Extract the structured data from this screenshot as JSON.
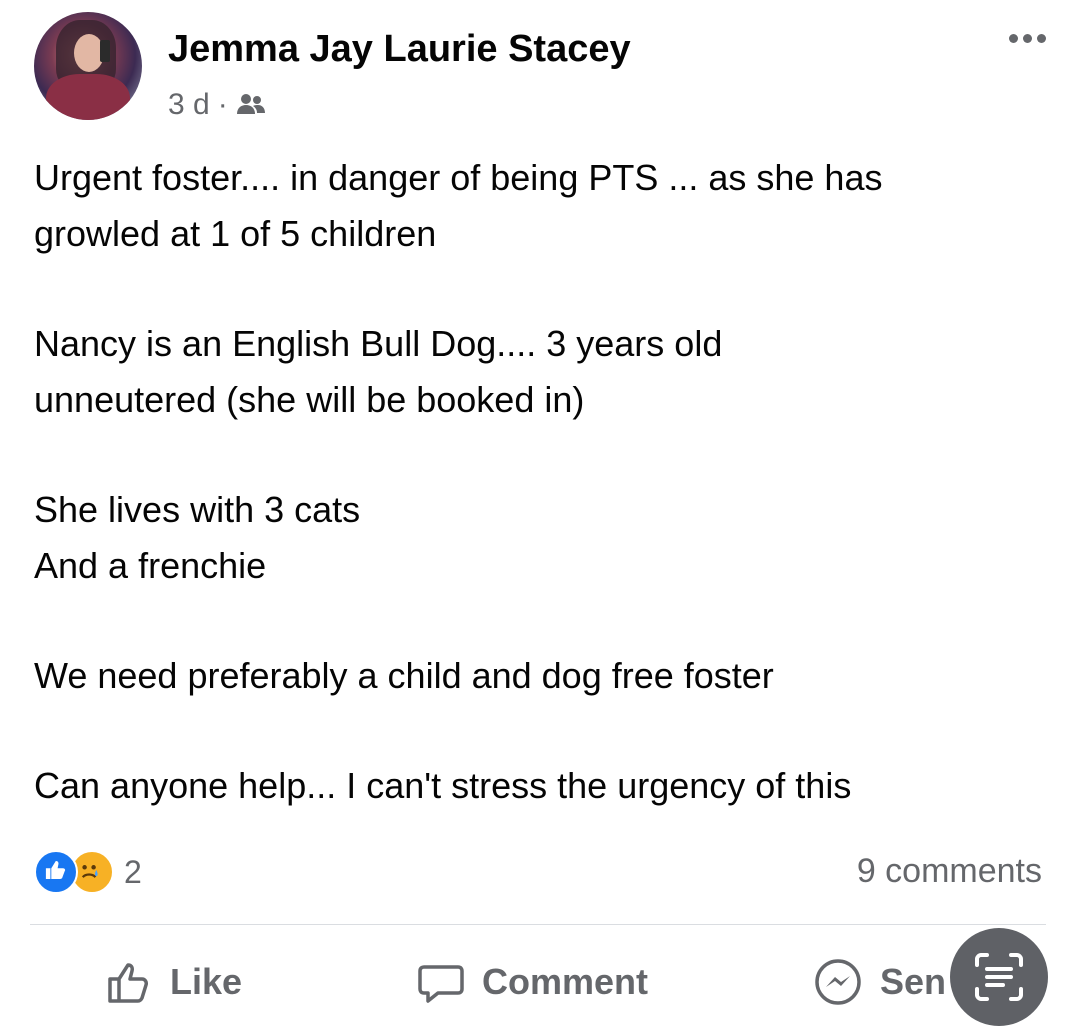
{
  "post": {
    "author": "Jemma Jay Laurie Stacey",
    "time": "3 d",
    "meta_separator": "·",
    "audience_icon": "friends-icon",
    "body": [
      "Urgent foster.... in danger of  being PTS ... as she has",
      "growled at 1 of 5 children",
      "Nancy is an English Bull Dog.... 3 years old",
      "unneutered (she will be booked in)",
      "She lives with 3 cats",
      "And a frenchie",
      "We need preferably a child and dog free foster",
      "Can anyone help... I can't stress the urgency of this"
    ]
  },
  "reactions": {
    "types": [
      "like",
      "sad"
    ],
    "count": "2",
    "comments": "9 comments"
  },
  "actions": {
    "like_label": "Like",
    "comment_label": "Comment",
    "send_label": "Sen"
  },
  "colors": {
    "like_blue": "#1877f2",
    "sad_yellow": "#f7b125",
    "secondary_text": "#65676b"
  }
}
